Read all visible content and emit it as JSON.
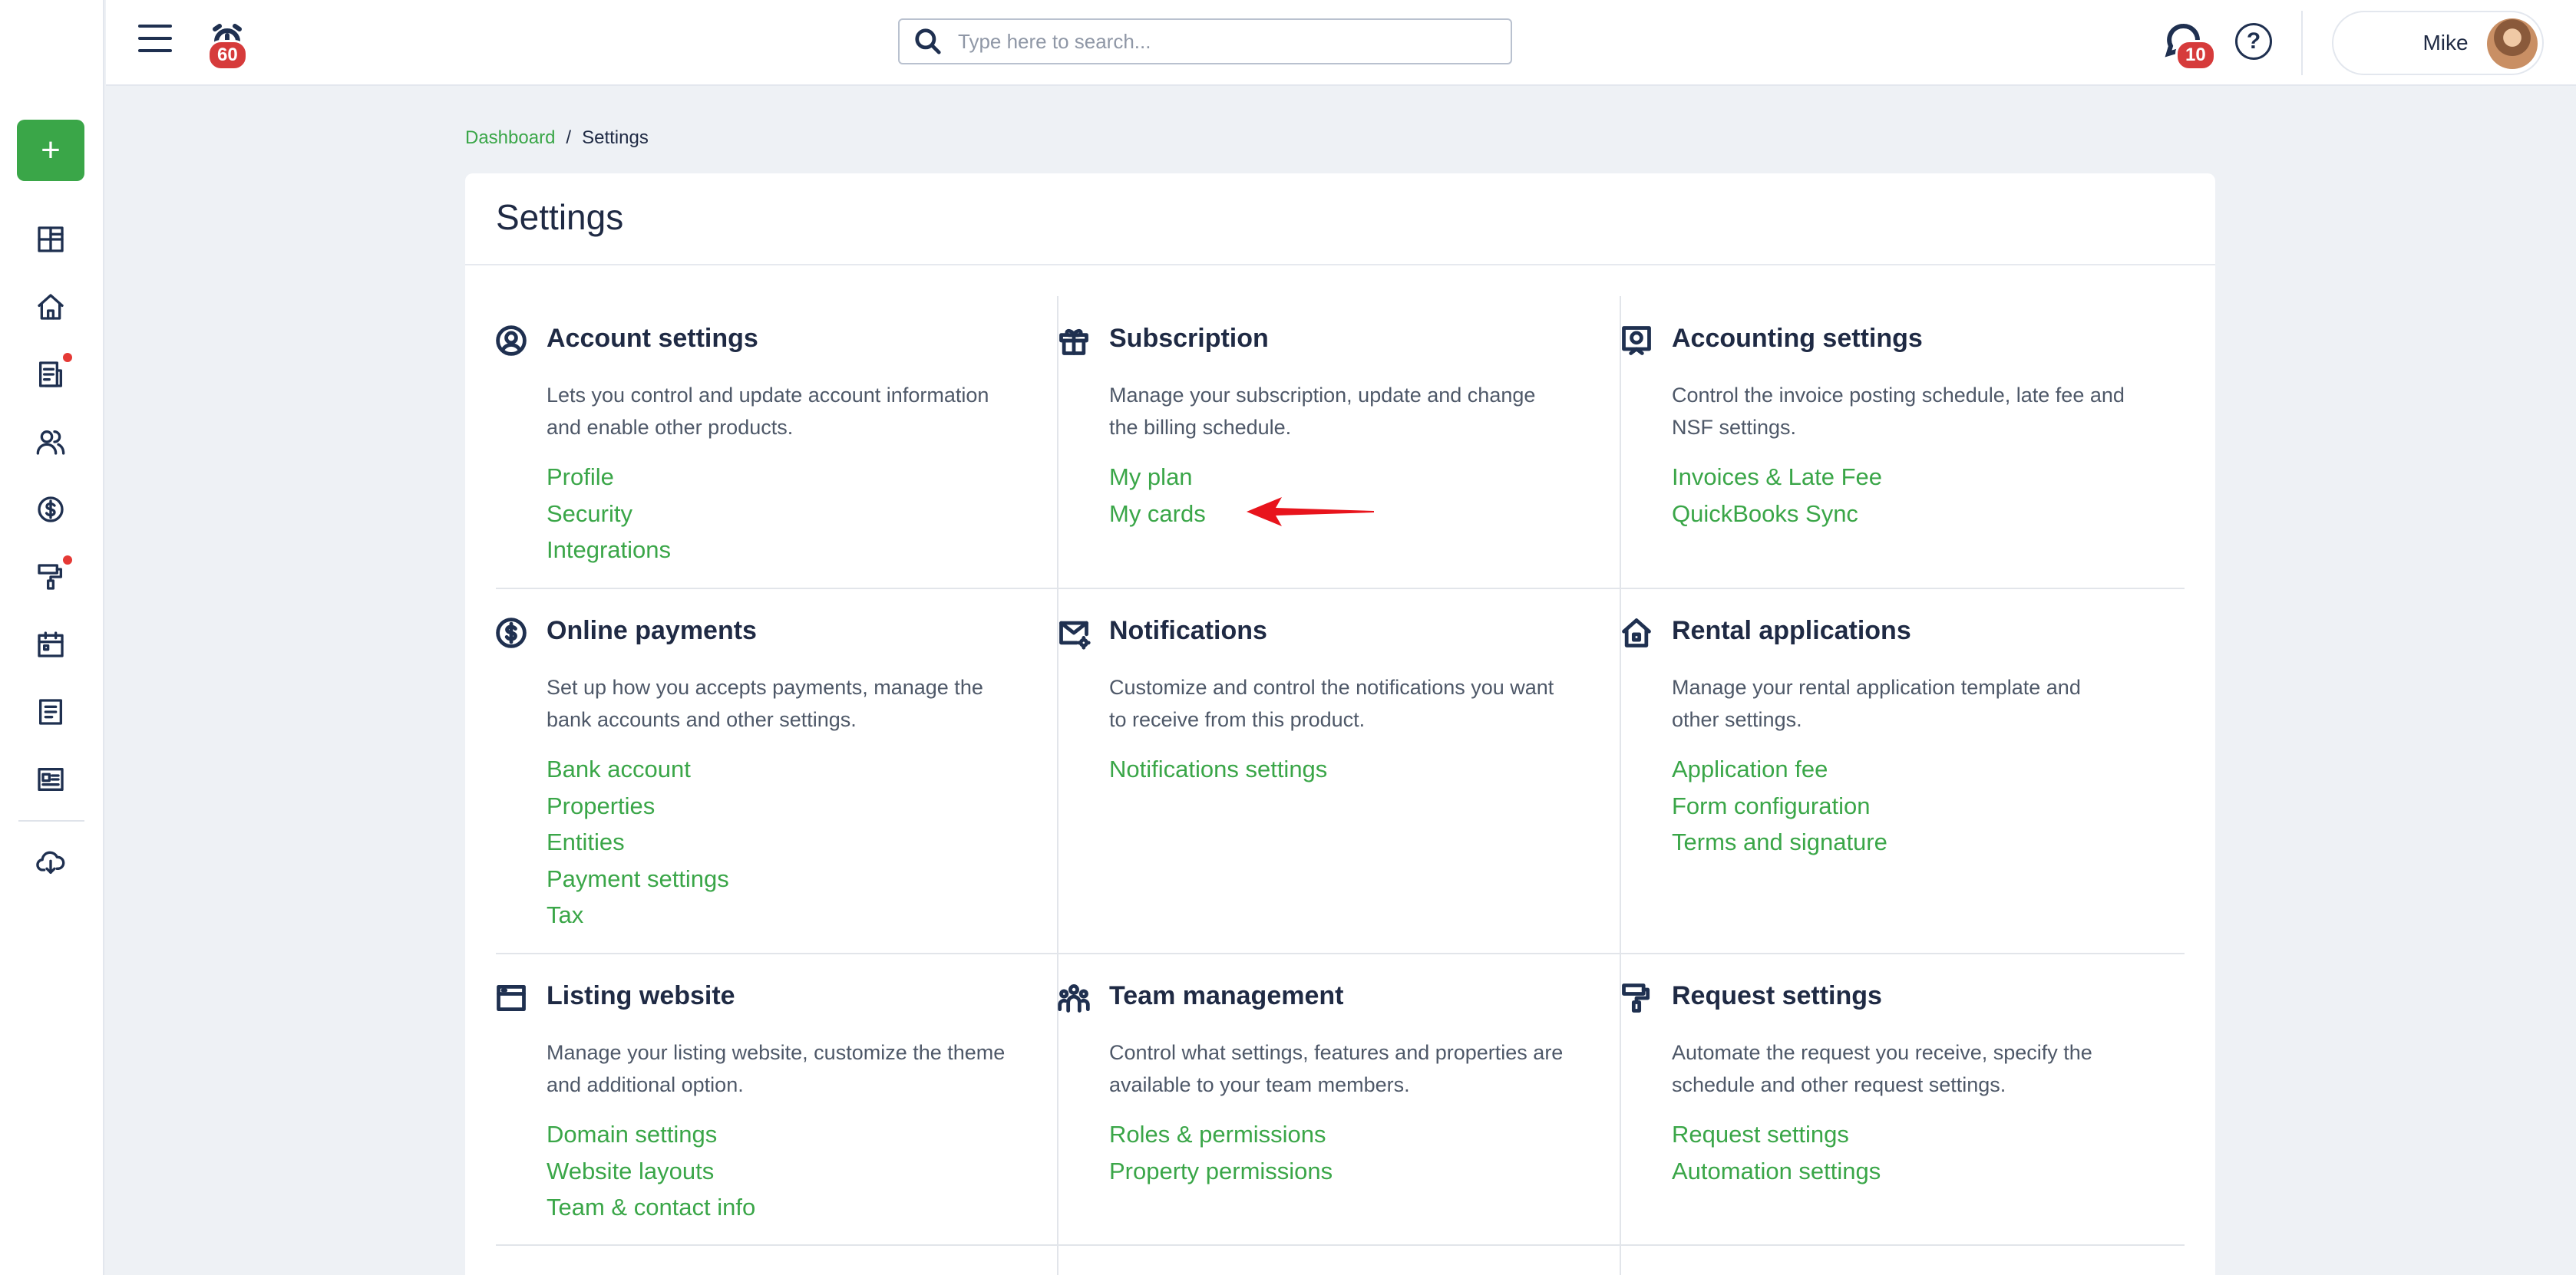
{
  "topbar": {
    "alarm_badge": "60",
    "search_placeholder": "Type here to search...",
    "chat_badge": "10",
    "help_label": "?",
    "user_name": "Mike"
  },
  "sidebar": {
    "add_label": "+",
    "items": [
      "dashboard-icon",
      "home-icon",
      "document-icon",
      "people-icon",
      "dollar-icon",
      "paint-roller-icon",
      "calendar-icon",
      "report-icon",
      "listing-icon",
      "download-icon"
    ]
  },
  "breadcrumb": {
    "link": "Dashboard",
    "separator": "/",
    "current": "Settings"
  },
  "page": {
    "title": "Settings"
  },
  "sections": [
    {
      "icon": "user-circle-icon",
      "title": "Account settings",
      "description": "Lets you control and update account information and enable other products.",
      "links": [
        "Profile",
        "Security",
        "Integrations"
      ]
    },
    {
      "icon": "gift-icon",
      "title": "Subscription",
      "description": "Manage your subscription, update and change the billing schedule.",
      "links": [
        "My plan",
        "My cards"
      ]
    },
    {
      "icon": "accounting-icon",
      "title": "Accounting settings",
      "description": "Control the invoice posting schedule, late fee and NSF settings.",
      "links": [
        "Invoices & Late Fee",
        "QuickBooks Sync"
      ]
    },
    {
      "icon": "dollar-circle-icon",
      "title": "Online payments",
      "description": "Set up how you accepts payments, manage the bank accounts and other settings.",
      "links": [
        "Bank account",
        "Properties",
        "Entities",
        "Payment settings",
        "Tax"
      ]
    },
    {
      "icon": "mail-gear-icon",
      "title": "Notifications",
      "description": "Customize and control the notifications you want to receive from this product.",
      "links": [
        "Notifications settings"
      ]
    },
    {
      "icon": "house-icon",
      "title": "Rental applications",
      "description": "Manage your rental application template and other settings.",
      "links": [
        "Application fee",
        "Form configuration",
        "Terms and signature"
      ]
    },
    {
      "icon": "browser-window-icon",
      "title": "Listing website",
      "description": "Manage your listing website, customize the theme and additional option.",
      "links": [
        "Domain settings",
        "Website layouts",
        "Team & contact info"
      ]
    },
    {
      "icon": "team-icon",
      "title": "Team management",
      "description": "Control what settings, features and properties are available to your team members.",
      "links": [
        "Roles & permissions",
        "Property permissions"
      ]
    },
    {
      "icon": "paint-roller-icon",
      "title": "Request settings",
      "description": "Automate the request you receive, specify the schedule and other request settings.",
      "links": [
        "Request settings",
        "Automation settings"
      ]
    }
  ],
  "annotation": {
    "arrow_color": "#e8141c"
  },
  "colors": {
    "accent": "#3aa648",
    "badge": "#d63b3b",
    "text": "#1f2a44"
  }
}
